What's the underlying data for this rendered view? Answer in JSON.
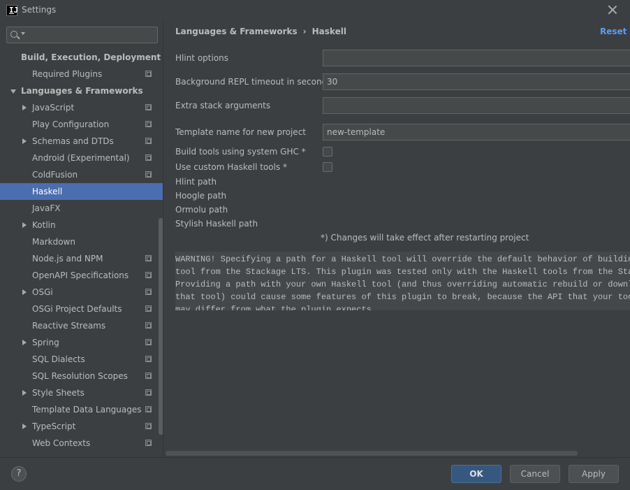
{
  "window": {
    "title": "Settings",
    "app_icon_glyph": "IJ"
  },
  "search": {
    "placeholder": "",
    "value": ""
  },
  "sidebar": {
    "items": [
      {
        "label": "Build, Execution, Deployment",
        "level": 0,
        "bold": true,
        "arrow": "none",
        "project_icon": false,
        "selected": false
      },
      {
        "label": "Required Plugins",
        "level": 1,
        "bold": false,
        "arrow": "none",
        "project_icon": true,
        "selected": false
      },
      {
        "label": "Languages & Frameworks",
        "level": 0,
        "bold": true,
        "arrow": "down",
        "project_icon": false,
        "selected": false
      },
      {
        "label": "JavaScript",
        "level": 1,
        "bold": false,
        "arrow": "right",
        "project_icon": true,
        "selected": false
      },
      {
        "label": "Play Configuration",
        "level": 1,
        "bold": false,
        "arrow": "none",
        "project_icon": true,
        "selected": false
      },
      {
        "label": "Schemas and DTDs",
        "level": 1,
        "bold": false,
        "arrow": "right",
        "project_icon": true,
        "selected": false
      },
      {
        "label": "Android (Experimental)",
        "level": 1,
        "bold": false,
        "arrow": "none",
        "project_icon": true,
        "selected": false
      },
      {
        "label": "ColdFusion",
        "level": 1,
        "bold": false,
        "arrow": "none",
        "project_icon": true,
        "selected": false
      },
      {
        "label": "Haskell",
        "level": 1,
        "bold": false,
        "arrow": "none",
        "project_icon": false,
        "selected": true
      },
      {
        "label": "JavaFX",
        "level": 1,
        "bold": false,
        "arrow": "none",
        "project_icon": false,
        "selected": false
      },
      {
        "label": "Kotlin",
        "level": 1,
        "bold": false,
        "arrow": "right",
        "project_icon": false,
        "selected": false
      },
      {
        "label": "Markdown",
        "level": 1,
        "bold": false,
        "arrow": "none",
        "project_icon": false,
        "selected": false
      },
      {
        "label": "Node.js and NPM",
        "level": 1,
        "bold": false,
        "arrow": "none",
        "project_icon": true,
        "selected": false
      },
      {
        "label": "OpenAPI Specifications",
        "level": 1,
        "bold": false,
        "arrow": "none",
        "project_icon": true,
        "selected": false
      },
      {
        "label": "OSGi",
        "level": 1,
        "bold": false,
        "arrow": "right",
        "project_icon": true,
        "selected": false
      },
      {
        "label": "OSGi Project Defaults",
        "level": 1,
        "bold": false,
        "arrow": "none",
        "project_icon": true,
        "selected": false
      },
      {
        "label": "Reactive Streams",
        "level": 1,
        "bold": false,
        "arrow": "none",
        "project_icon": true,
        "selected": false
      },
      {
        "label": "Spring",
        "level": 1,
        "bold": false,
        "arrow": "right",
        "project_icon": true,
        "selected": false
      },
      {
        "label": "SQL Dialects",
        "level": 1,
        "bold": false,
        "arrow": "none",
        "project_icon": true,
        "selected": false
      },
      {
        "label": "SQL Resolution Scopes",
        "level": 1,
        "bold": false,
        "arrow": "none",
        "project_icon": true,
        "selected": false
      },
      {
        "label": "Style Sheets",
        "level": 1,
        "bold": false,
        "arrow": "right",
        "project_icon": true,
        "selected": false
      },
      {
        "label": "Template Data Languages",
        "level": 1,
        "bold": false,
        "arrow": "none",
        "project_icon": true,
        "selected": false
      },
      {
        "label": "TypeScript",
        "level": 1,
        "bold": false,
        "arrow": "right",
        "project_icon": true,
        "selected": false
      },
      {
        "label": "Web Contexts",
        "level": 1,
        "bold": false,
        "arrow": "none",
        "project_icon": true,
        "selected": false
      }
    ]
  },
  "header": {
    "breadcrumb_parent": "Languages & Frameworks",
    "breadcrumb_separator": "›",
    "breadcrumb_current": "Haskell",
    "reset_label": "Reset"
  },
  "form": {
    "hlint_options_label": "Hlint options",
    "hlint_options_value": "",
    "repl_timeout_label": "Background REPL timeout in seconds *",
    "repl_timeout_value": "30",
    "extra_stack_label": "Extra stack arguments",
    "extra_stack_value": "",
    "template_name_label": "Template name for new project",
    "template_name_value": "new-template",
    "build_tools_label": "Build tools using system GHC *",
    "build_tools_checked": false,
    "custom_tools_label": "Use custom Haskell tools *",
    "custom_tools_checked": false,
    "hlint_path_label": "Hlint path",
    "hoogle_path_label": "Hoogle path",
    "ormolu_path_label": "Ormolu path",
    "stylish_path_label": "Stylish Haskell path",
    "restart_note": "*) Changes will take effect after restarting project"
  },
  "warning": {
    "lines": [
      "WARNING! Specifying a path for a Haskell tool will override the default behavior of building",
      "tool from the Stackage LTS. This plugin was tested only with the Haskell tools from the Stack",
      "Providing a path with your own Haskell tool (and thus overriding automatic rebuild or downloa",
      "that tool) could cause some features of this plugin to break, because the API that your tool",
      "may differ from what the plugin expects."
    ]
  },
  "footer": {
    "help_label": "?",
    "ok_label": "OK",
    "cancel_label": "Cancel",
    "apply_label": "Apply"
  },
  "colors": {
    "background": "#3c3f41",
    "selection": "#4b6eaf",
    "link": "#589df6",
    "primary_button": "#365880"
  }
}
